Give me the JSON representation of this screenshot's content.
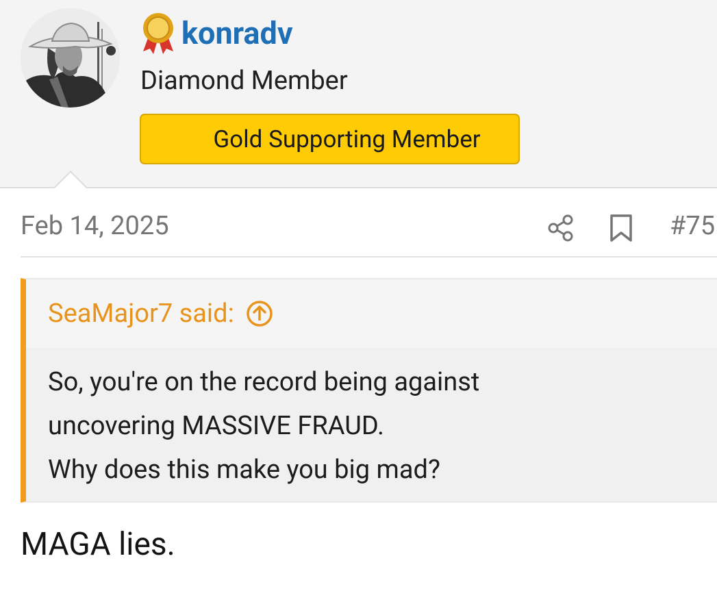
{
  "user": {
    "username": "konradv",
    "title": "Diamond Member",
    "banner": "Gold Supporting Member",
    "avatar_icon": "avatar-photo",
    "medal_icon": "gold-medal-icon"
  },
  "post": {
    "date": "Feb 14, 2025",
    "number": "#75",
    "share_icon": "share-icon",
    "bookmark_icon": "bookmark-icon"
  },
  "quote": {
    "author_said": "SeaMajor7 said:",
    "lines": [
      "So, you're on the record being against",
      "uncovering MASSIVE FRAUD.",
      "Why does this make you big mad?"
    ]
  },
  "reply": {
    "text": "MAGA lies."
  },
  "colors": {
    "username": "#1e6fb5",
    "banner_bg": "#ffcb05",
    "quote_accent": "#f39b1a",
    "muted_text": "#757575"
  }
}
